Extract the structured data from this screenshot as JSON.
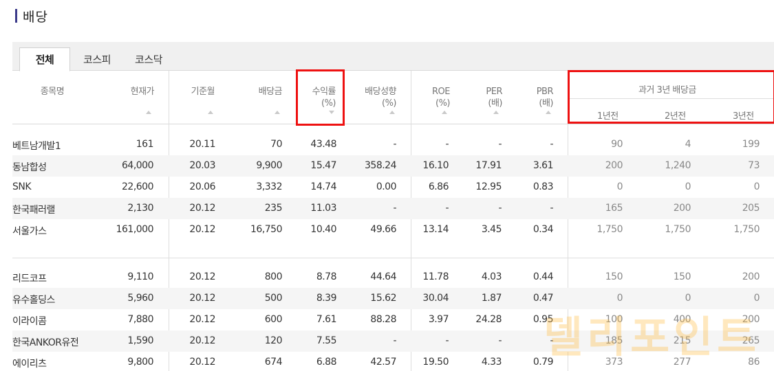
{
  "title": "배당",
  "tabs": [
    "전체",
    "코스피",
    "코스닥"
  ],
  "columns": {
    "name": "종목명",
    "price": "현재가",
    "base_month": "기준월",
    "dividend": "배당금",
    "yield": "수익률",
    "yield_unit": "(%)",
    "payout": "배당성향",
    "payout_unit": "(%)",
    "roe": "ROE",
    "roe_unit": "(%)",
    "per": "PER",
    "per_unit": "(배)",
    "pbr": "PBR",
    "pbr_unit": "(배)",
    "past_group": "과거 3년 배당금",
    "y1": "1년전",
    "y2": "2년전",
    "y3": "3년전"
  },
  "rows": [
    {
      "name": "베트남개발1",
      "price": "161",
      "month": "20.11",
      "div": "70",
      "yield": "43.48",
      "payout": "-",
      "roe": "-",
      "per": "-",
      "pbr": "-",
      "y1": "90",
      "y2": "4",
      "y3": "199"
    },
    {
      "name": "동남합성",
      "price": "64,000",
      "month": "20.03",
      "div": "9,900",
      "yield": "15.47",
      "payout": "358.24",
      "roe": "16.10",
      "per": "17.91",
      "pbr": "3.61",
      "y1": "200",
      "y2": "1,240",
      "y3": "73"
    },
    {
      "name": "SNK",
      "price": "22,600",
      "month": "20.06",
      "div": "3,332",
      "yield": "14.74",
      "payout": "0.00",
      "roe": "6.86",
      "per": "12.95",
      "pbr": "0.83",
      "y1": "0",
      "y2": "0",
      "y3": "0"
    },
    {
      "name": "한국패러랠",
      "price": "2,130",
      "month": "20.12",
      "div": "235",
      "yield": "11.03",
      "payout": "-",
      "roe": "-",
      "per": "-",
      "pbr": "-",
      "y1": "165",
      "y2": "200",
      "y3": "205"
    },
    {
      "name": "서울가스",
      "price": "161,000",
      "month": "20.12",
      "div": "16,750",
      "yield": "10.40",
      "payout": "49.66",
      "roe": "13.14",
      "per": "3.45",
      "pbr": "0.34",
      "y1": "1,750",
      "y2": "1,750",
      "y3": "1,750"
    },
    {
      "name": "리드코프",
      "price": "9,110",
      "month": "20.12",
      "div": "800",
      "yield": "8.78",
      "payout": "44.64",
      "roe": "11.78",
      "per": "4.03",
      "pbr": "0.44",
      "y1": "150",
      "y2": "150",
      "y3": "200"
    },
    {
      "name": "유수홀딩스",
      "price": "5,960",
      "month": "20.12",
      "div": "500",
      "yield": "8.39",
      "payout": "15.62",
      "roe": "30.04",
      "per": "1.87",
      "pbr": "0.47",
      "y1": "0",
      "y2": "0",
      "y3": "0"
    },
    {
      "name": "이라이콤",
      "price": "7,880",
      "month": "20.12",
      "div": "600",
      "yield": "7.61",
      "payout": "88.28",
      "roe": "3.97",
      "per": "24.28",
      "pbr": "0.95",
      "y1": "100",
      "y2": "400",
      "y3": "200"
    },
    {
      "name": "한국ANKOR유전",
      "price": "1,590",
      "month": "20.12",
      "div": "120",
      "yield": "7.55",
      "payout": "-",
      "roe": "-",
      "per": "-",
      "pbr": "-",
      "y1": "185",
      "y2": "215",
      "y3": "265"
    },
    {
      "name": "에이리츠",
      "price": "9,800",
      "month": "20.12",
      "div": "674",
      "yield": "6.88",
      "payout": "42.57",
      "roe": "19.50",
      "per": "4.33",
      "pbr": "0.79",
      "y1": "373",
      "y2": "277",
      "y3": "86"
    }
  ],
  "watermark": "델리포인트",
  "colors": {
    "accent": "#3b3a8a",
    "highlight_box": "#ee1111",
    "row_shade": "#f5f5f5"
  }
}
